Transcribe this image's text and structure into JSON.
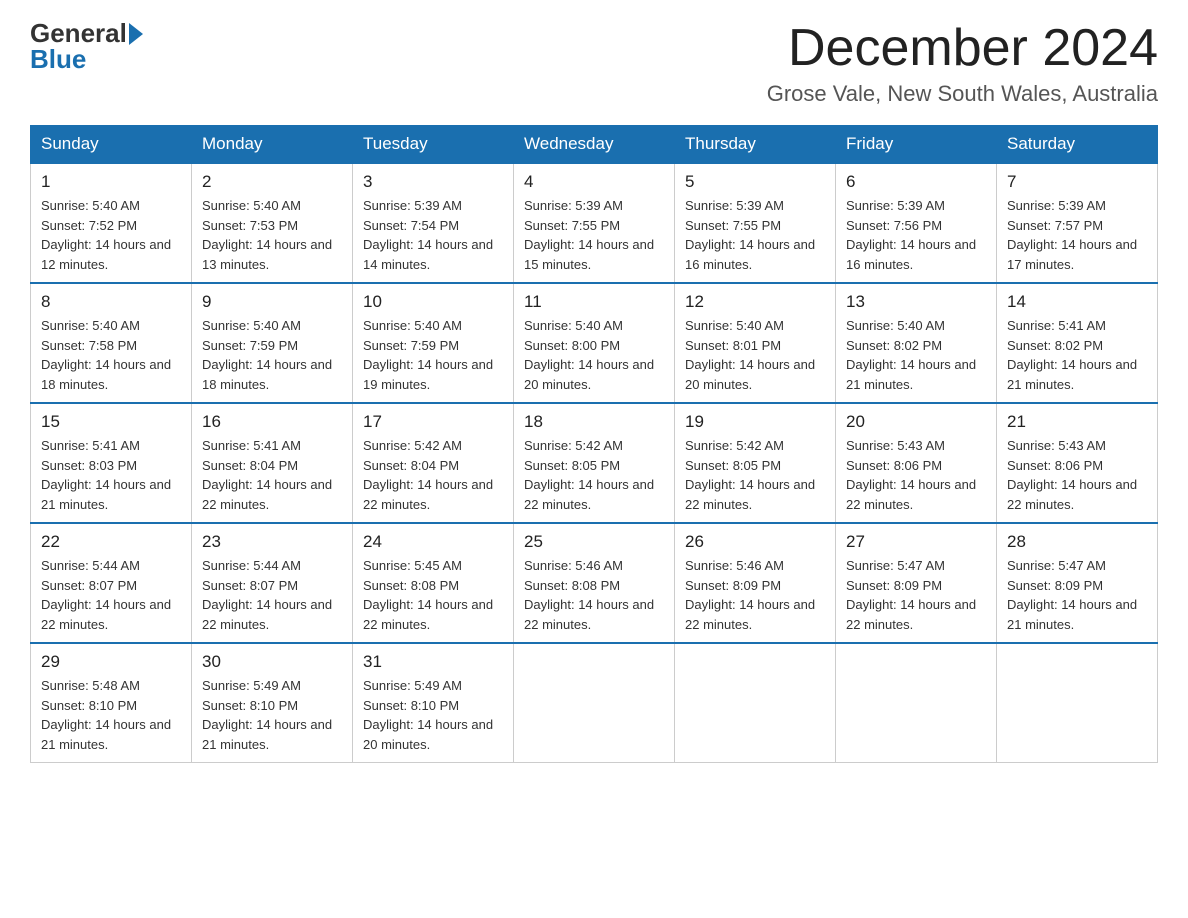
{
  "logo": {
    "general": "General",
    "blue": "Blue"
  },
  "title": {
    "month": "December 2024",
    "location": "Grose Vale, New South Wales, Australia"
  },
  "headers": [
    "Sunday",
    "Monday",
    "Tuesday",
    "Wednesday",
    "Thursday",
    "Friday",
    "Saturday"
  ],
  "weeks": [
    [
      {
        "day": "1",
        "sunrise": "5:40 AM",
        "sunset": "7:52 PM",
        "daylight": "14 hours and 12 minutes."
      },
      {
        "day": "2",
        "sunrise": "5:40 AM",
        "sunset": "7:53 PM",
        "daylight": "14 hours and 13 minutes."
      },
      {
        "day": "3",
        "sunrise": "5:39 AM",
        "sunset": "7:54 PM",
        "daylight": "14 hours and 14 minutes."
      },
      {
        "day": "4",
        "sunrise": "5:39 AM",
        "sunset": "7:55 PM",
        "daylight": "14 hours and 15 minutes."
      },
      {
        "day": "5",
        "sunrise": "5:39 AM",
        "sunset": "7:55 PM",
        "daylight": "14 hours and 16 minutes."
      },
      {
        "day": "6",
        "sunrise": "5:39 AM",
        "sunset": "7:56 PM",
        "daylight": "14 hours and 16 minutes."
      },
      {
        "day": "7",
        "sunrise": "5:39 AM",
        "sunset": "7:57 PM",
        "daylight": "14 hours and 17 minutes."
      }
    ],
    [
      {
        "day": "8",
        "sunrise": "5:40 AM",
        "sunset": "7:58 PM",
        "daylight": "14 hours and 18 minutes."
      },
      {
        "day": "9",
        "sunrise": "5:40 AM",
        "sunset": "7:59 PM",
        "daylight": "14 hours and 18 minutes."
      },
      {
        "day": "10",
        "sunrise": "5:40 AM",
        "sunset": "7:59 PM",
        "daylight": "14 hours and 19 minutes."
      },
      {
        "day": "11",
        "sunrise": "5:40 AM",
        "sunset": "8:00 PM",
        "daylight": "14 hours and 20 minutes."
      },
      {
        "day": "12",
        "sunrise": "5:40 AM",
        "sunset": "8:01 PM",
        "daylight": "14 hours and 20 minutes."
      },
      {
        "day": "13",
        "sunrise": "5:40 AM",
        "sunset": "8:02 PM",
        "daylight": "14 hours and 21 minutes."
      },
      {
        "day": "14",
        "sunrise": "5:41 AM",
        "sunset": "8:02 PM",
        "daylight": "14 hours and 21 minutes."
      }
    ],
    [
      {
        "day": "15",
        "sunrise": "5:41 AM",
        "sunset": "8:03 PM",
        "daylight": "14 hours and 21 minutes."
      },
      {
        "day": "16",
        "sunrise": "5:41 AM",
        "sunset": "8:04 PM",
        "daylight": "14 hours and 22 minutes."
      },
      {
        "day": "17",
        "sunrise": "5:42 AM",
        "sunset": "8:04 PM",
        "daylight": "14 hours and 22 minutes."
      },
      {
        "day": "18",
        "sunrise": "5:42 AM",
        "sunset": "8:05 PM",
        "daylight": "14 hours and 22 minutes."
      },
      {
        "day": "19",
        "sunrise": "5:42 AM",
        "sunset": "8:05 PM",
        "daylight": "14 hours and 22 minutes."
      },
      {
        "day": "20",
        "sunrise": "5:43 AM",
        "sunset": "8:06 PM",
        "daylight": "14 hours and 22 minutes."
      },
      {
        "day": "21",
        "sunrise": "5:43 AM",
        "sunset": "8:06 PM",
        "daylight": "14 hours and 22 minutes."
      }
    ],
    [
      {
        "day": "22",
        "sunrise": "5:44 AM",
        "sunset": "8:07 PM",
        "daylight": "14 hours and 22 minutes."
      },
      {
        "day": "23",
        "sunrise": "5:44 AM",
        "sunset": "8:07 PM",
        "daylight": "14 hours and 22 minutes."
      },
      {
        "day": "24",
        "sunrise": "5:45 AM",
        "sunset": "8:08 PM",
        "daylight": "14 hours and 22 minutes."
      },
      {
        "day": "25",
        "sunrise": "5:46 AM",
        "sunset": "8:08 PM",
        "daylight": "14 hours and 22 minutes."
      },
      {
        "day": "26",
        "sunrise": "5:46 AM",
        "sunset": "8:09 PM",
        "daylight": "14 hours and 22 minutes."
      },
      {
        "day": "27",
        "sunrise": "5:47 AM",
        "sunset": "8:09 PM",
        "daylight": "14 hours and 22 minutes."
      },
      {
        "day": "28",
        "sunrise": "5:47 AM",
        "sunset": "8:09 PM",
        "daylight": "14 hours and 21 minutes."
      }
    ],
    [
      {
        "day": "29",
        "sunrise": "5:48 AM",
        "sunset": "8:10 PM",
        "daylight": "14 hours and 21 minutes."
      },
      {
        "day": "30",
        "sunrise": "5:49 AM",
        "sunset": "8:10 PM",
        "daylight": "14 hours and 21 minutes."
      },
      {
        "day": "31",
        "sunrise": "5:49 AM",
        "sunset": "8:10 PM",
        "daylight": "14 hours and 20 minutes."
      },
      null,
      null,
      null,
      null
    ]
  ]
}
